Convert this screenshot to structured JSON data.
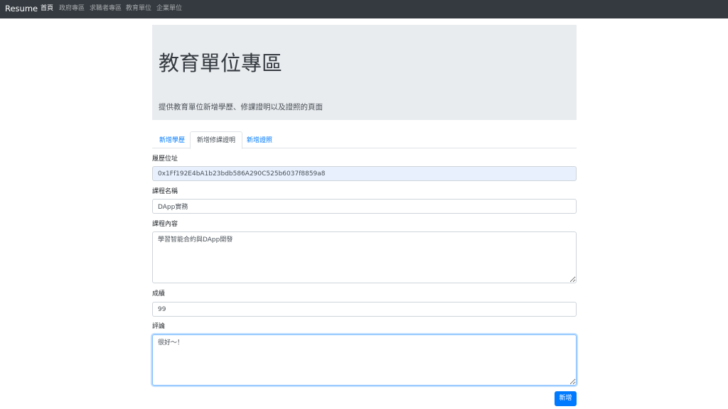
{
  "navbar": {
    "brand": "Resume",
    "links": [
      {
        "label": "首頁",
        "active": true
      },
      {
        "label": "政府專區",
        "active": false
      },
      {
        "label": "求職者專區",
        "active": false
      },
      {
        "label": "教育單位",
        "active": false
      },
      {
        "label": "企業單位",
        "active": false
      }
    ]
  },
  "jumbotron": {
    "title": "教育單位專區",
    "subtitle": "提供教育單位新增學歷、修課證明以及證照的頁面"
  },
  "tabs": [
    {
      "label": "新增學歷",
      "active": false
    },
    {
      "label": "新增修課證明",
      "active": true
    },
    {
      "label": "新增證照",
      "active": false
    }
  ],
  "form": {
    "address": {
      "label": "履歷位址",
      "value": "0x1Ff192E4bA1b23bdb586A290C525b6037f8859a8"
    },
    "course_name": {
      "label": "課程名稱",
      "value": "DApp實務"
    },
    "course_content": {
      "label": "課程內容",
      "value": "學習智能合約與DApp開發"
    },
    "score": {
      "label": "成績",
      "value": "99"
    },
    "comment": {
      "label": "評論",
      "value": "很好～！"
    },
    "submit_label": "新增"
  },
  "colors": {
    "navbar_bg": "#343a40",
    "jumbotron_bg": "#e9ecef",
    "primary": "#007bff"
  }
}
